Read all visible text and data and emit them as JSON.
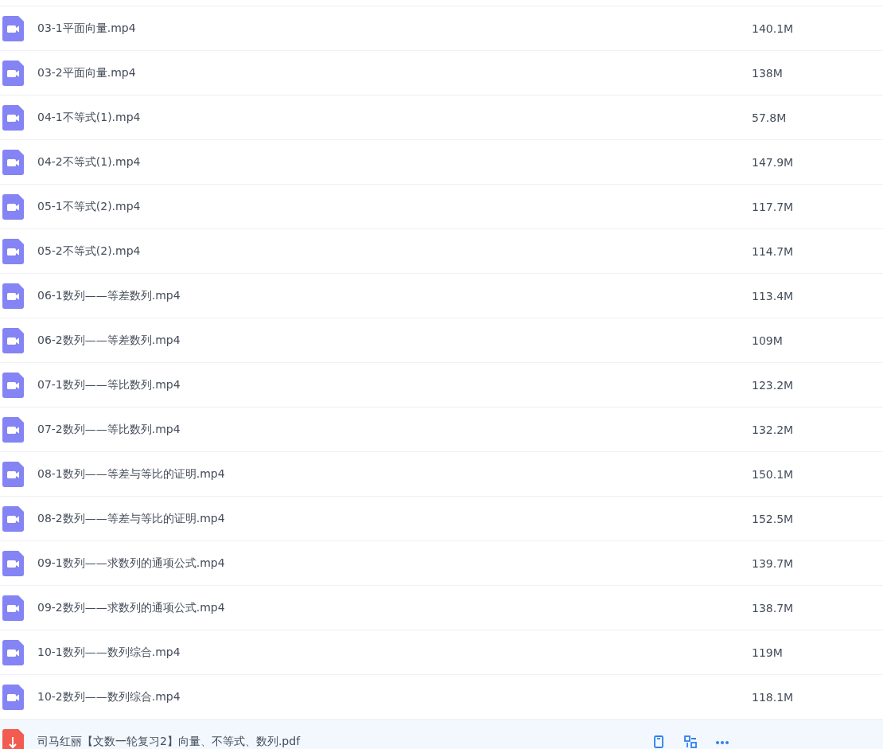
{
  "files": [
    {
      "kind": "video",
      "name": "03-1平面向量.mp4",
      "size": "140.1M",
      "hovered": false
    },
    {
      "kind": "video",
      "name": "03-2平面向量.mp4",
      "size": "138M",
      "hovered": false
    },
    {
      "kind": "video",
      "name": "04-1不等式(1).mp4",
      "size": "57.8M",
      "hovered": false
    },
    {
      "kind": "video",
      "name": "04-2不等式(1).mp4",
      "size": "147.9M",
      "hovered": false
    },
    {
      "kind": "video",
      "name": "05-1不等式(2).mp4",
      "size": "117.7M",
      "hovered": false
    },
    {
      "kind": "video",
      "name": "05-2不等式(2).mp4",
      "size": "114.7M",
      "hovered": false
    },
    {
      "kind": "video",
      "name": "06-1数列——等差数列.mp4",
      "size": "113.4M",
      "hovered": false
    },
    {
      "kind": "video",
      "name": "06-2数列——等差数列.mp4",
      "size": "109M",
      "hovered": false
    },
    {
      "kind": "video",
      "name": "07-1数列——等比数列.mp4",
      "size": "123.2M",
      "hovered": false
    },
    {
      "kind": "video",
      "name": "07-2数列——等比数列.mp4",
      "size": "132.2M",
      "hovered": false
    },
    {
      "kind": "video",
      "name": "08-1数列——等差与等比的证明.mp4",
      "size": "150.1M",
      "hovered": false
    },
    {
      "kind": "video",
      "name": "08-2数列——等差与等比的证明.mp4",
      "size": "152.5M",
      "hovered": false
    },
    {
      "kind": "video",
      "name": "09-1数列——求数列的通项公式.mp4",
      "size": "139.7M",
      "hovered": false
    },
    {
      "kind": "video",
      "name": "09-2数列——求数列的通项公式.mp4",
      "size": "138.7M",
      "hovered": false
    },
    {
      "kind": "video",
      "name": "10-1数列——数列综合.mp4",
      "size": "119M",
      "hovered": false
    },
    {
      "kind": "video",
      "name": "10-2数列——数列综合.mp4",
      "size": "118.1M",
      "hovered": false
    },
    {
      "kind": "pdf",
      "name": "司马红丽【文数一轮复习2】向量、不等式、数列.pdf",
      "hovered": true
    }
  ]
}
